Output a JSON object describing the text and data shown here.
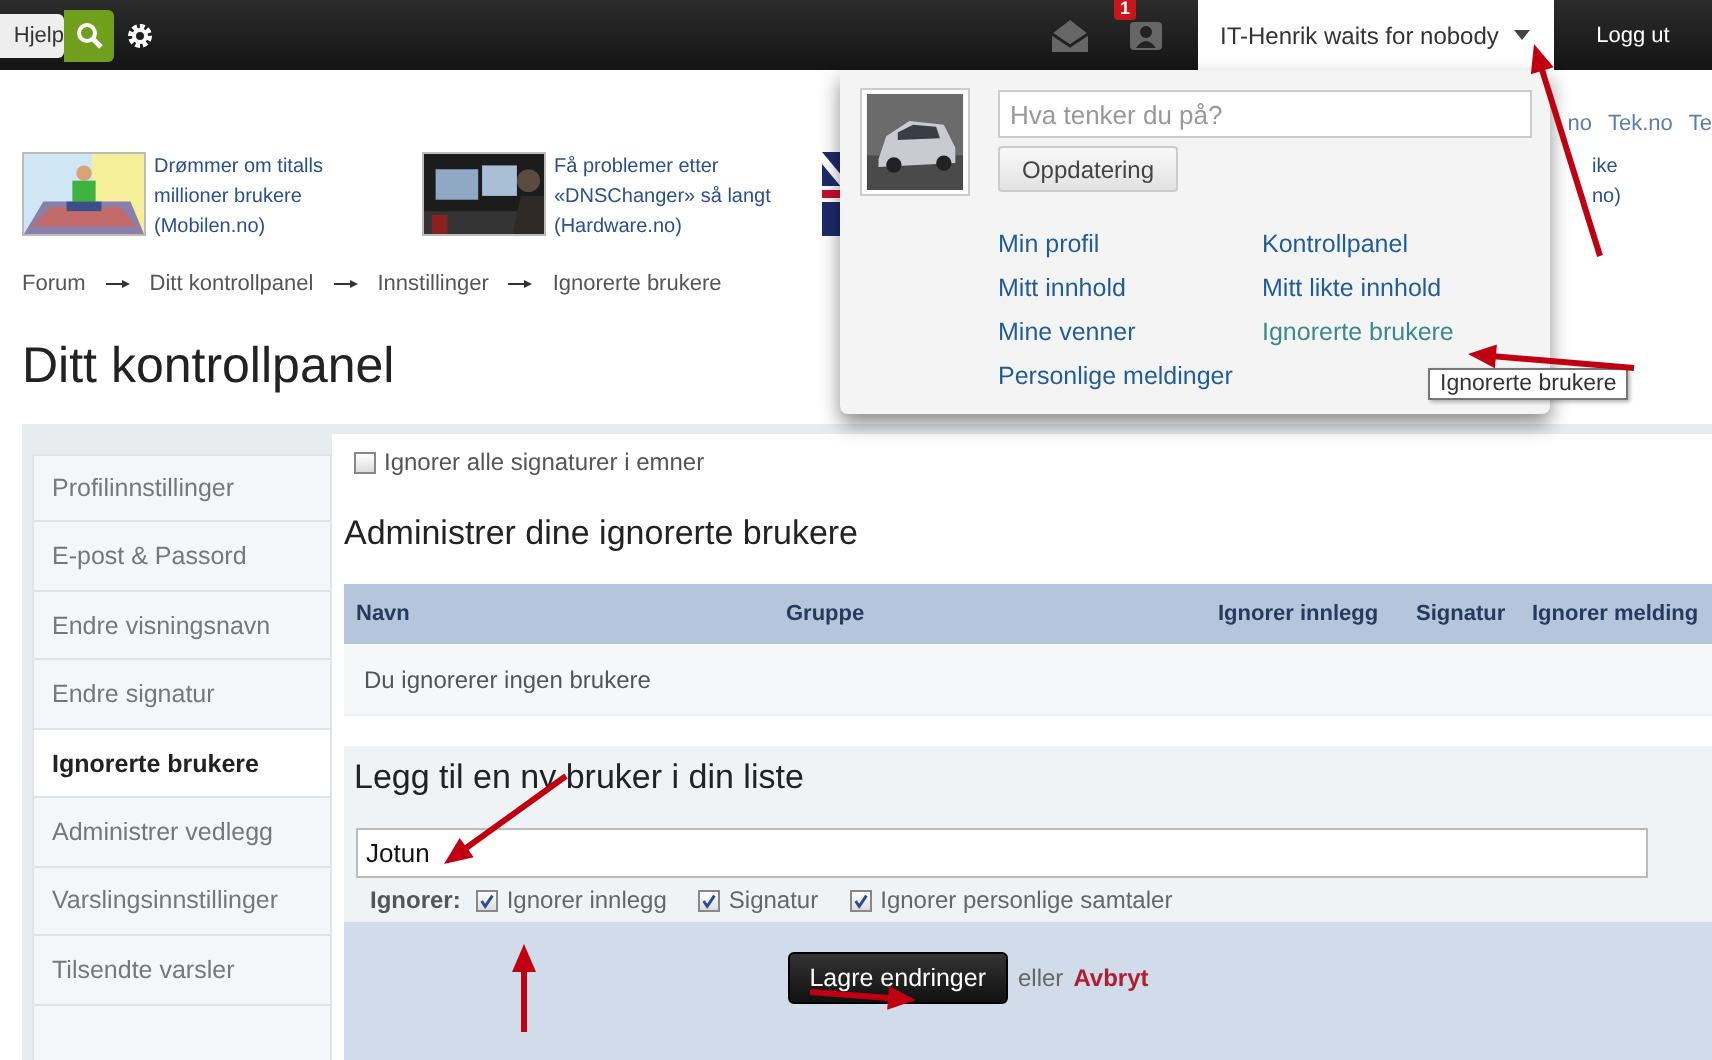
{
  "topbar": {
    "search_placeholder": "Hjelp",
    "badge": "1",
    "user_name": "IT-Henrik waits for nobody",
    "logout": "Logg ut"
  },
  "site_links": [
    "no",
    "Tek.no",
    "Te"
  ],
  "news": [
    {
      "lines": [
        "Drømmer om titalls",
        "millioner brukere",
        "(Mobilen.no)"
      ]
    },
    {
      "lines": [
        "Få problemer etter",
        "«DNSChanger» så langt",
        "(Hardware.no)"
      ]
    }
  ],
  "news_fragments": [
    "ike",
    "no)"
  ],
  "breadcrumb": [
    "Forum",
    "Ditt kontrollpanel",
    "Innstillinger",
    "Ignorerte brukere"
  ],
  "page_title": "Ditt kontrollpanel",
  "sidebar": [
    {
      "label": "Profilinnstillinger",
      "selected": false
    },
    {
      "label": "E-post & Passord",
      "selected": false
    },
    {
      "label": "Endre visningsnavn",
      "selected": false
    },
    {
      "label": "Endre signatur",
      "selected": false
    },
    {
      "label": "Ignorerte brukere",
      "selected": true
    },
    {
      "label": "Administrer vedlegg",
      "selected": false
    },
    {
      "label": "Varslingsinnstillinger",
      "selected": false
    },
    {
      "label": "Tilsendte varsler",
      "selected": false
    }
  ],
  "ignore_all_signatures": {
    "label": "Ignorer alle signaturer i emner",
    "checked": false
  },
  "manage_heading": "Administrer dine ignorerte brukere",
  "table": {
    "columns": [
      "Navn",
      "Gruppe",
      "Ignorer innlegg",
      "Signatur",
      "Ignorer melding"
    ],
    "empty_message": "Du ignorerer ingen brukere"
  },
  "add_heading": "Legg til en ny bruker i din liste",
  "add_user": {
    "value": "Jotun",
    "ignore_label": "Ignorer:",
    "options": [
      {
        "label": "Ignorer innlegg",
        "checked": true
      },
      {
        "label": "Signatur",
        "checked": true
      },
      {
        "label": "Ignorer personlige samtaler",
        "checked": true
      }
    ]
  },
  "save_button": "Lagre endringer",
  "or_text": "eller",
  "cancel_link": "Avbryt",
  "user_menu": {
    "status_placeholder": "Hva tenker du på?",
    "update_button": "Oppdatering",
    "links": [
      {
        "label": "Min profil",
        "highlighted": false
      },
      {
        "label": "Kontrollpanel",
        "highlighted": false
      },
      {
        "label": "Mitt innhold",
        "highlighted": false
      },
      {
        "label": "Mitt likte innhold",
        "highlighted": false
      },
      {
        "label": "Mine venner",
        "highlighted": false
      },
      {
        "label": "Ignorerte brukere",
        "highlighted": true
      },
      {
        "label": "Personlige meldinger",
        "highlighted": false
      }
    ]
  },
  "tooltip": "Ignorerte brukere"
}
